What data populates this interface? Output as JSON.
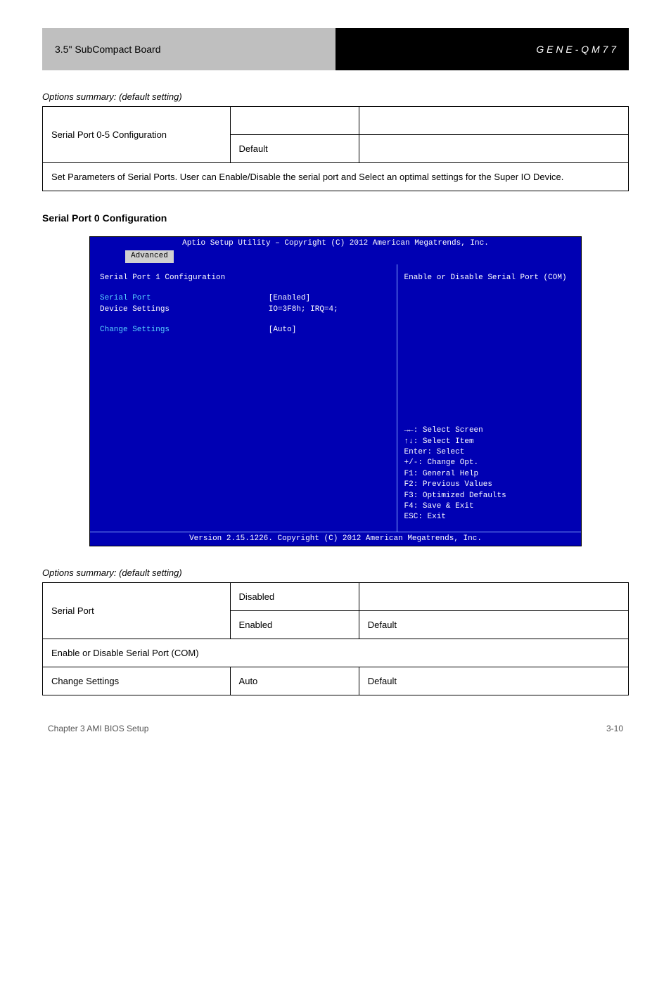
{
  "header": {
    "left": "3.5\" SubCompact Board",
    "right": "G E N E - Q M 7 7"
  },
  "table1": {
    "options_label": "Options summary: (default setting)",
    "name": "Serial Port 0-5 Configuration",
    "default": "Default",
    "description": "Set Parameters of Serial Ports. User can Enable/Disable the serial port and Select an optimal settings for the Super IO Device."
  },
  "section_title": "Serial Port 0 Configuration",
  "bios": {
    "title_bar": "Aptio Setup Utility – Copyright (C) 2012 American Megatrends, Inc.",
    "tab": "Advanced",
    "panel_title": "Serial Port 1 Configuration",
    "rows": {
      "serial_port_lbl": "Serial Port",
      "serial_port_val": "[Enabled]",
      "device_settings_lbl": "Device Settings",
      "device_settings_val": "IO=3F8h; IRQ=4;",
      "change_settings_lbl": "Change Settings",
      "change_settings_val": "[Auto]"
    },
    "help_text": "Enable or Disable Serial Port (COM)",
    "keys": [
      {
        "k": "→←:",
        "t": " Select Screen"
      },
      {
        "k": "↑↓:",
        "t": " Select Item"
      },
      {
        "k": "Enter:",
        "t": " Select"
      },
      {
        "k": "+/-:",
        "t": " Change Opt."
      },
      {
        "k": "F1:",
        "t": " General Help"
      },
      {
        "k": "F2:",
        "t": " Previous Values"
      },
      {
        "k": "F3:",
        "t": " Optimized Defaults"
      },
      {
        "k": "F4:",
        "t": " Save & Exit"
      },
      {
        "k": "ESC:",
        "t": " Exit"
      }
    ],
    "footer": "Version 2.15.1226. Copyright (C) 2012 American Megatrends, Inc."
  },
  "table2": {
    "options_label": "Options summary: (default setting)",
    "serial_port_name": "Serial Port",
    "serial_port_opt1": "Disabled",
    "serial_port_opt2": "Enabled",
    "serial_port_default": "Default",
    "serial_port_desc": "Enable or Disable Serial Port (COM)",
    "change_name": "Change Settings",
    "change_opt1": "Auto",
    "change_default": "Default"
  },
  "footer": {
    "left": "Chapter 3 AMI BIOS Setup",
    "right": "3-10"
  }
}
